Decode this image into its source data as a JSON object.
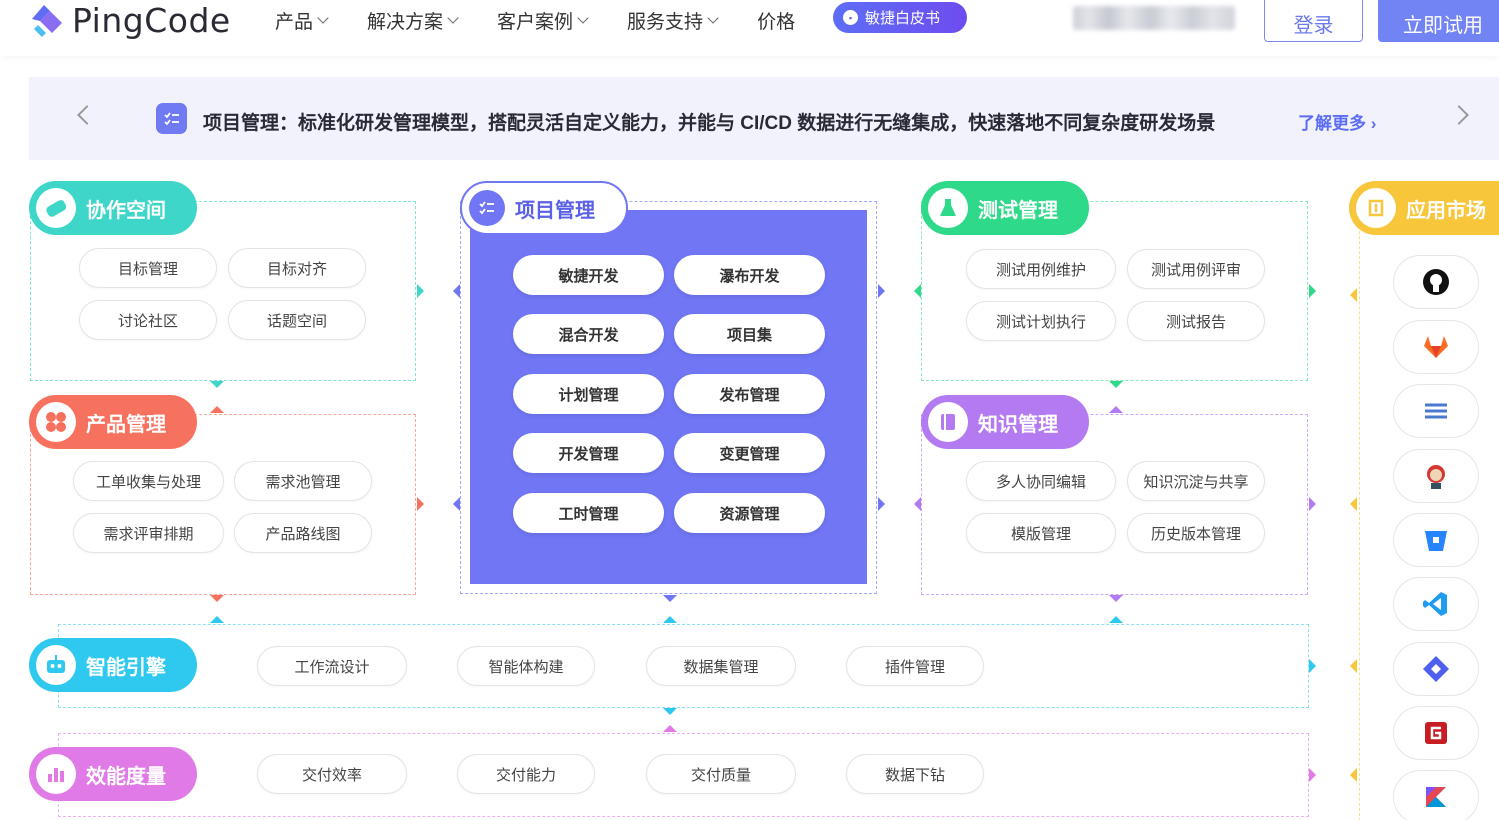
{
  "header": {
    "brand": "PingCode",
    "nav": [
      {
        "label": "产品",
        "has_dropdown": true
      },
      {
        "label": "解决方案",
        "has_dropdown": true
      },
      {
        "label": "客户案例",
        "has_dropdown": true
      },
      {
        "label": "服务支持",
        "has_dropdown": true
      },
      {
        "label": "价格",
        "has_dropdown": false
      }
    ],
    "whitepaper_label": "敏捷白皮书",
    "login_label": "登录",
    "trial_label": "立即试用"
  },
  "banner": {
    "text": "项目管理：标准化研发管理模型，搭配灵活自定义能力，并能与 CI/CD 数据进行无缝集成，快速落地不同复杂度研发场景",
    "more_label": "了解更多 ›"
  },
  "modules": {
    "collab": {
      "title": "协作空间",
      "color": "#3dd6c8",
      "items": [
        "目标管理",
        "目标对齐",
        "讨论社区",
        "话题空间"
      ]
    },
    "product": {
      "title": "产品管理",
      "color": "#f7715f",
      "items": [
        "工单收集与处理",
        "需求池管理",
        "需求评审排期",
        "产品路线图"
      ]
    },
    "project": {
      "title": "项目管理",
      "color": "#7076f4",
      "items": [
        "敏捷开发",
        "瀑布开发",
        "混合开发",
        "项目集",
        "计划管理",
        "发布管理",
        "开发管理",
        "变更管理",
        "工时管理",
        "资源管理"
      ]
    },
    "test": {
      "title": "测试管理",
      "color": "#2fd98a",
      "items": [
        "测试用例维护",
        "测试用例评审",
        "测试计划执行",
        "测试报告"
      ]
    },
    "wiki": {
      "title": "知识管理",
      "color": "#b47af1",
      "items": [
        "多人协同编辑",
        "知识沉淀与共享",
        "模版管理",
        "历史版本管理"
      ]
    },
    "engine": {
      "title": "智能引擎",
      "color": "#2fc8ee",
      "items": [
        "工作流设计",
        "智能体构建",
        "数据集管理",
        "插件管理"
      ]
    },
    "metrics": {
      "title": "效能度量",
      "color": "#e07ae6",
      "items": [
        "交付效率",
        "交付能力",
        "交付质量",
        "数据下钻"
      ]
    },
    "market": {
      "title": "应用市场",
      "color": "#f7c63a",
      "apps": [
        "github-icon",
        "gitlab-icon",
        "jfrog-icon",
        "jenkins-icon",
        "bitbucket-icon",
        "vscode-icon",
        "jira-icon",
        "gitee-icon",
        "kotlin-icon"
      ]
    }
  }
}
